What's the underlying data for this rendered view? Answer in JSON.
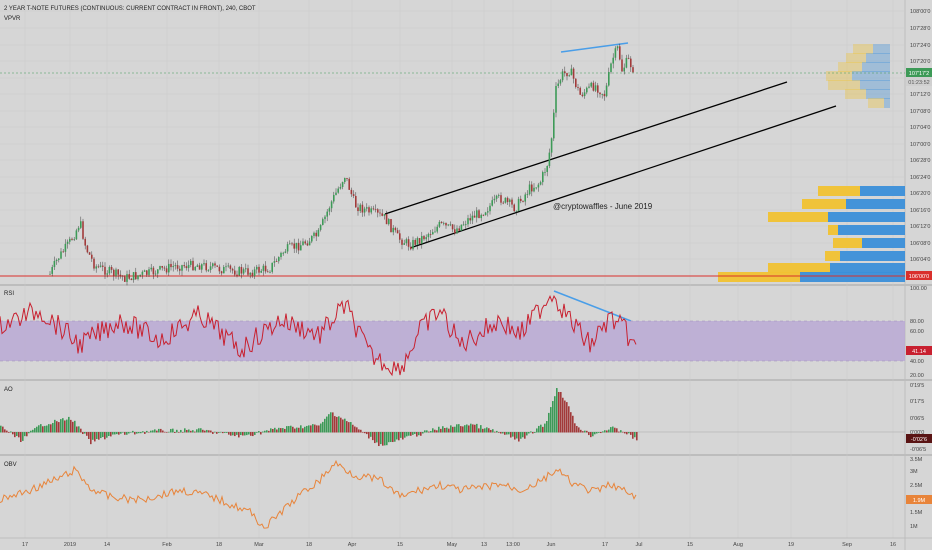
{
  "header": {
    "title": "2 YEAR T-NOTE FUTURES (CONTINUOUS: CURRENT CONTRACT IN FRONT), 240, CBOT",
    "indicator": "VPVR"
  },
  "colors": {
    "background": "#d6d6d6",
    "candle_up": "#3d9a57",
    "candle_down": "#a23a3a",
    "rsi_line": "#c8202f",
    "rsi_band": "#b8a6d4",
    "obv_line": "#e8843a",
    "trendline_blue": "#4a9ee8",
    "support_line": "#d9302c",
    "vp_yellow": "#f1c232",
    "vp_blue": "#3b8fd9"
  },
  "annotation": "@cryptowaffles - June 2019",
  "price_axis": {
    "labels": [
      "108'00'0",
      "107'28'0",
      "107'24'0",
      "107'20'0",
      "107'16'0",
      "107'12'0",
      "107'08'0",
      "107'04'0",
      "107'00'0",
      "106'28'0",
      "106'24'0",
      "106'20'0",
      "106'16'0",
      "106'12'0",
      "106'08'0",
      "106'04'0",
      "106'00'0"
    ],
    "badges": {
      "current": "107'17'2",
      "countdown": "01:23:52",
      "support": "106'00'0"
    }
  },
  "rsi": {
    "label": "RSI",
    "axis": [
      "100.00",
      "80.00",
      "60.00",
      "40.00",
      "20.00"
    ],
    "badge": "41.14"
  },
  "ao": {
    "label": "AO",
    "axis": [
      "0'19'5",
      "0'17'5",
      "0'06'5",
      "0'00'0",
      "-0'06'5"
    ],
    "badge": "-0'02'6"
  },
  "obv": {
    "label": "OBV",
    "axis": [
      "3.5M",
      "3M",
      "2.5M",
      "2M",
      "1.5M",
      "1M"
    ],
    "badge": "1.9M"
  },
  "time_axis": [
    "17",
    "2019",
    "14",
    "Feb",
    "18",
    "Mar",
    "18",
    "Apr",
    "15",
    "May",
    "13",
    "13:00",
    "Jun",
    "17",
    "Jul",
    "15",
    "Aug",
    "19",
    "Sep",
    "16"
  ],
  "chart_data": {
    "type": "candlestick",
    "indicators": [
      "VPVR",
      "RSI",
      "AO",
      "OBV"
    ],
    "price_axis_range": [
      "106'00'0",
      "108'00'0"
    ],
    "rsi_range": [
      20,
      100
    ],
    "rsi_band": [
      30,
      70
    ],
    "price_close_keypoints": [
      {
        "x": "early Jan",
        "y": "106'03'0"
      },
      {
        "x": "early Jan",
        "y": "106'13'0"
      },
      {
        "x": "mid Jan",
        "y": "106'02'0"
      },
      {
        "x": "mid Feb",
        "y": "106'03'0"
      },
      {
        "x": "early Mar",
        "y": "106'02'0"
      },
      {
        "x": "late Mar",
        "y": "106'25'0"
      },
      {
        "x": "early Apr",
        "y": "106'17'0"
      },
      {
        "x": "mid Apr",
        "y": "106'10'0"
      },
      {
        "x": "late Apr",
        "y": "106'15'0"
      },
      {
        "x": "mid May",
        "y": "106'17'0"
      },
      {
        "x": "late May",
        "y": "106'28'0"
      },
      {
        "x": "early Jun",
        "y": "107'15'0"
      },
      {
        "x": "mid Jun",
        "y": "107'17'0"
      },
      {
        "x": "late Jun",
        "y": "107'17'2"
      }
    ]
  }
}
